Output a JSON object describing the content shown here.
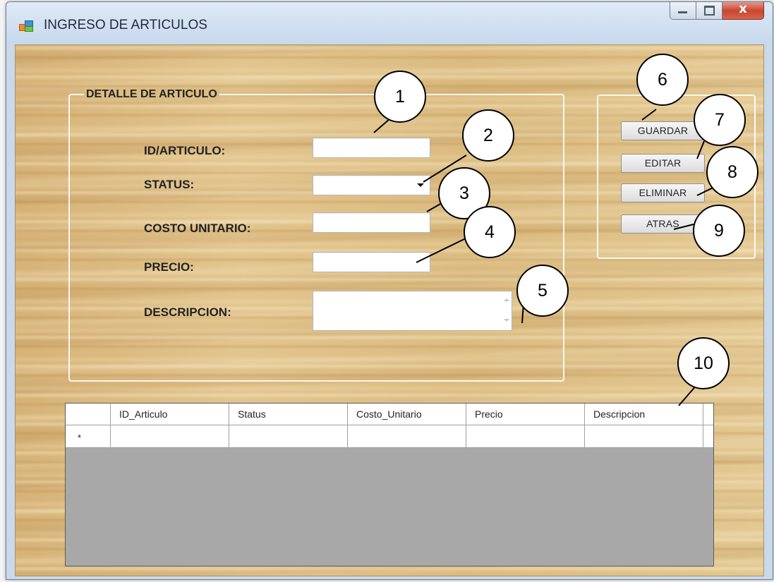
{
  "window": {
    "title": "INGRESO DE ARTICULOS",
    "close_glyph": "x"
  },
  "detail_group": {
    "legend": "DETALLE DE ARTICULO",
    "labels": {
      "id": "ID/ARTICULO:",
      "status": "STATUS:",
      "cost": "COSTO UNITARIO:",
      "price": "PRECIO:",
      "description": "DESCRIPCION:"
    },
    "values": {
      "id": "",
      "status": "",
      "cost": "",
      "price": "",
      "description": ""
    }
  },
  "actions": {
    "save": "GUARDAR",
    "edit": "EDITAR",
    "delete": "ELIMINAR",
    "back": "ATRAS"
  },
  "grid": {
    "columns": [
      "ID_Articulo",
      "Status",
      "Costo_Unitario",
      "Precio",
      "Descripcion"
    ],
    "new_row_marker": "*"
  },
  "callouts": [
    "1",
    "2",
    "3",
    "4",
    "5",
    "6",
    "7",
    "8",
    "9",
    "10"
  ]
}
